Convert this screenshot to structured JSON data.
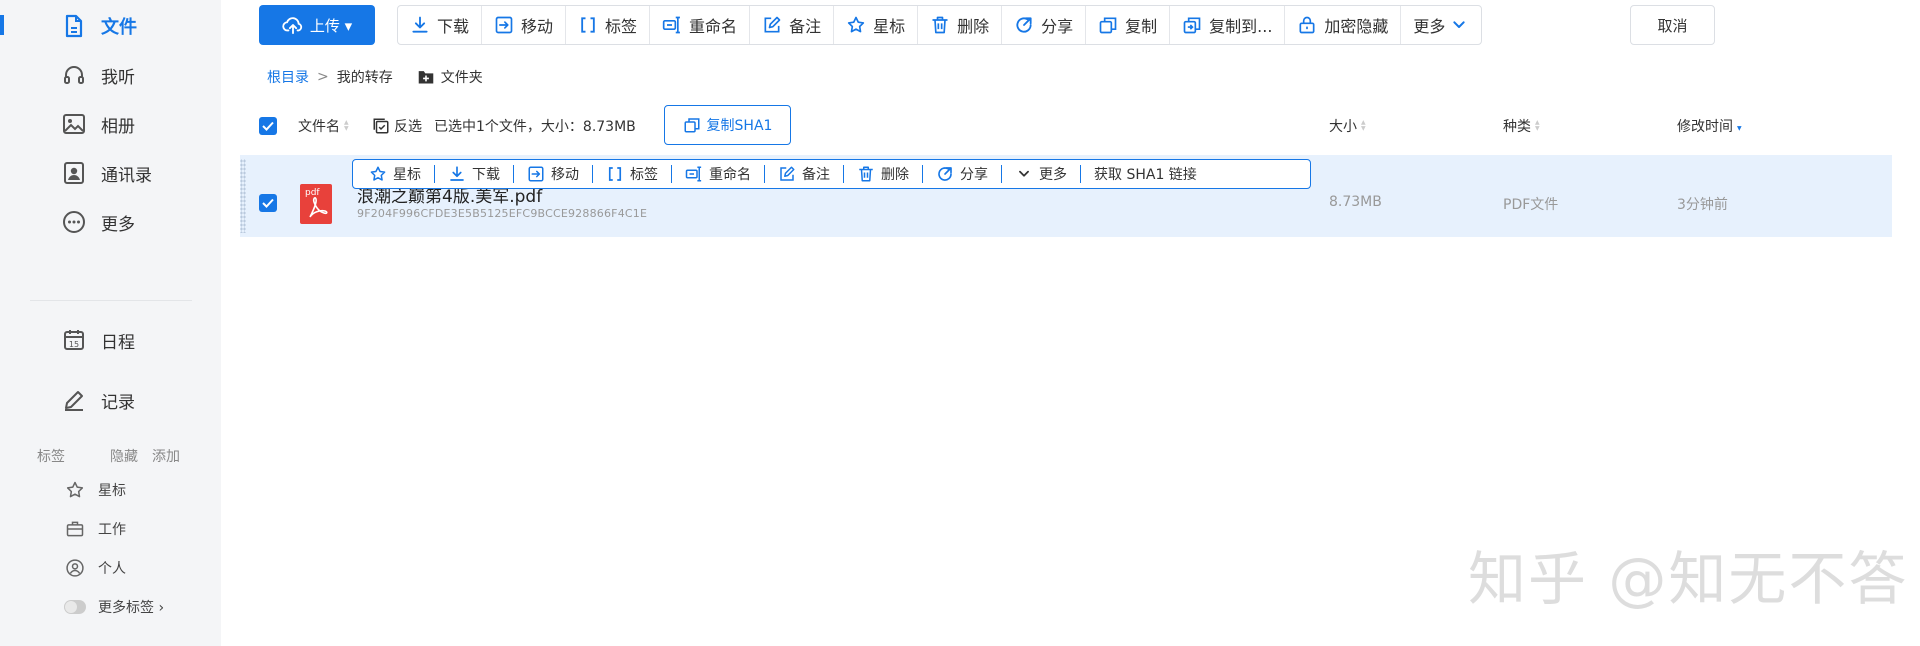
{
  "sidebar": {
    "nav": [
      {
        "label": "文件",
        "icon": "file-icon",
        "active": true
      },
      {
        "label": "我听",
        "icon": "headphones-icon"
      },
      {
        "label": "相册",
        "icon": "image-icon"
      },
      {
        "label": "通讯录",
        "icon": "contacts-icon"
      },
      {
        "label": "更多",
        "icon": "more-circle-icon"
      },
      {
        "label": "日程",
        "icon": "calendar-icon",
        "badge": "15"
      },
      {
        "label": "记录",
        "icon": "pen-icon"
      }
    ],
    "tags_title": "标签",
    "tags_hide": "隐藏",
    "tags_add": "添加",
    "tags": [
      {
        "label": "星标",
        "icon": "star-icon"
      },
      {
        "label": "工作",
        "icon": "briefcase-icon"
      },
      {
        "label": "个人",
        "icon": "user-icon"
      },
      {
        "label": "更多标签 ›",
        "icon": "toggle-icon"
      }
    ]
  },
  "toolbar": {
    "upload_label": "上传 ▾",
    "buttons": [
      {
        "label": "下载",
        "icon": "download-icon"
      },
      {
        "label": "移动",
        "icon": "move-icon"
      },
      {
        "label": "标签",
        "icon": "bracket-tag-icon"
      },
      {
        "label": "重命名",
        "icon": "rename-icon"
      },
      {
        "label": "备注",
        "icon": "edit-icon"
      },
      {
        "label": "星标",
        "icon": "star-icon"
      },
      {
        "label": "删除",
        "icon": "trash-icon"
      },
      {
        "label": "分享",
        "icon": "share-icon"
      },
      {
        "label": "复制",
        "icon": "copy-icon"
      },
      {
        "label": "复制到...",
        "icon": "copy-to-icon"
      },
      {
        "label": "加密隐藏",
        "icon": "lock-icon"
      },
      {
        "label": "更多",
        "icon": "chevron-down-icon"
      }
    ],
    "cancel_label": "取消"
  },
  "breadcrumb": {
    "root": "根目录",
    "separator": ">",
    "current": "我的转存",
    "new_folder": "文件夹"
  },
  "list_header": {
    "name": "文件名",
    "invert_select": "反选",
    "selection_info": "已选中1个文件，大小：8.73MB",
    "copy_sha": "复制SHA1",
    "size": "大小",
    "type": "种类",
    "modified": "修改时间"
  },
  "file": {
    "name": "浪潮之巅第4版.美军.pdf",
    "sha1": "9F204F996CFDE3E5B5125EFC9BCCE928866F4C1E",
    "size": "8.73MB",
    "type": "PDF文件",
    "modified": "3分钟前",
    "icon_label": "pdf"
  },
  "row_actions": [
    {
      "label": "星标",
      "icon": "star-icon"
    },
    {
      "label": "下载",
      "icon": "download-icon"
    },
    {
      "label": "移动",
      "icon": "move-icon"
    },
    {
      "label": "标签",
      "icon": "bracket-tag-icon"
    },
    {
      "label": "重命名",
      "icon": "rename-icon"
    },
    {
      "label": "备注",
      "icon": "edit-icon"
    },
    {
      "label": "删除",
      "icon": "trash-icon"
    },
    {
      "label": "分享",
      "icon": "share-icon"
    },
    {
      "label": "更多",
      "icon": "chevron-down-icon"
    },
    {
      "label": "获取 SHA1 链接",
      "icon": ""
    }
  ],
  "watermark": "知乎 @知无不答",
  "colors": {
    "accent": "#1677e6",
    "selected_row": "#e7f1fd",
    "sidebar_bg": "#f4f5f7",
    "pdf_red": "#e8413b"
  }
}
